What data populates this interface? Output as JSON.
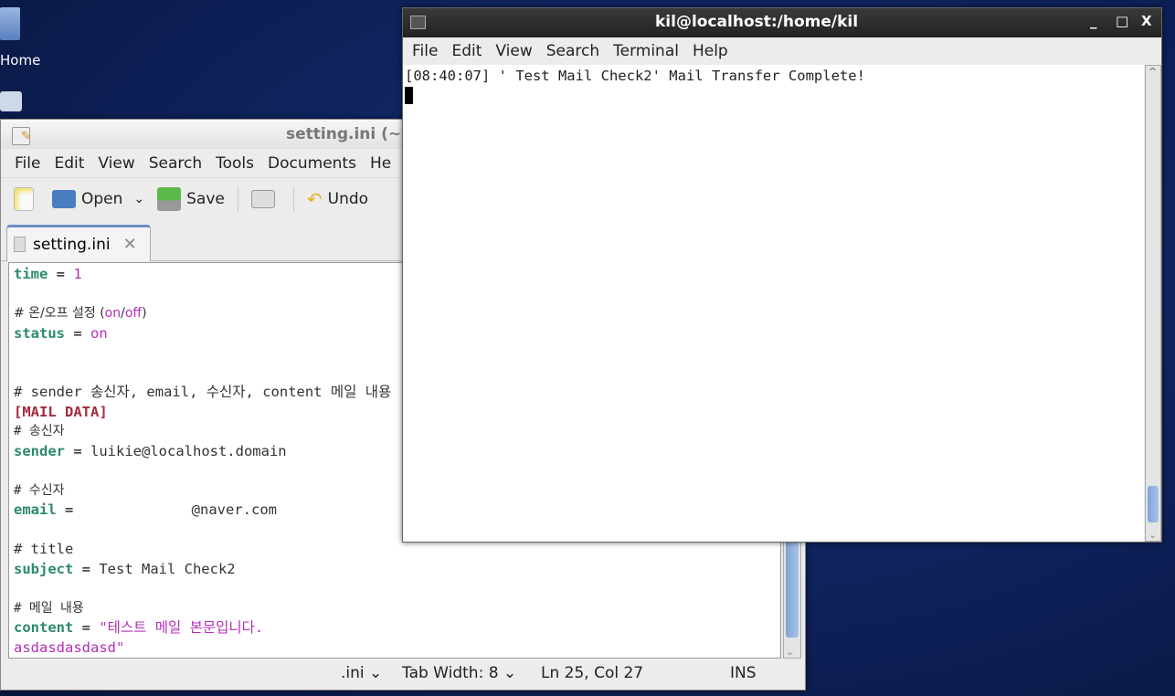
{
  "desktop": {
    "home_label": "Home"
  },
  "editor": {
    "title": "setting.ini (~",
    "menu": [
      "File",
      "Edit",
      "View",
      "Search",
      "Tools",
      "Documents",
      "He"
    ],
    "toolbar": {
      "open": "Open",
      "save": "Save",
      "undo": "Undo"
    },
    "tab": "setting.ini",
    "lines": {
      "l0k": "time",
      "l0v": "1",
      "l2": "# 온/오프 설정 (",
      "l2a": "on",
      "l2b": "/",
      "l2c": "off",
      "l2d": ")",
      "l3k": "status",
      "l3v": "on",
      "l6": "# sender 송신자, email, 수신자, content 메일 내용",
      "l7": "[MAIL DATA]",
      "l8": "# 송신자",
      "l9k": "sender",
      "l9v": "luikie@localhost.domain",
      "l11": "# 수신자",
      "l12k": "email",
      "l12v": "@naver.com",
      "l14": "# title",
      "l15k": "subject",
      "l15v": "Test Mail Check2",
      "l17": "# 메일 내용",
      "l18k": "content",
      "l18v": "\"테스트 메일 본문입니다.",
      "l19": "asdasdasdasd\""
    },
    "eq": " = ",
    "status": {
      "lang": ".ini ⌄",
      "tab_width": "Tab Width:  8 ⌄",
      "position": "Ln 25, Col 27",
      "mode": "INS"
    }
  },
  "terminal": {
    "title": "kil@localhost:/home/kil",
    "menu": [
      "File",
      "Edit",
      "View",
      "Search",
      "Terminal",
      "Help"
    ],
    "output": "[08:40:07] ' Test Mail Check2' Mail Transfer Complete!",
    "controls": {
      "min": "_",
      "max": "□",
      "close": "X"
    }
  }
}
